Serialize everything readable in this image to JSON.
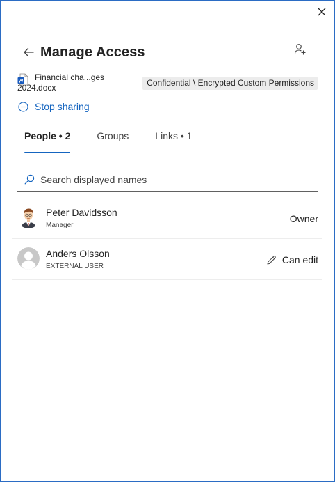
{
  "panel": {
    "title": "Manage Access",
    "close_icon": "close-icon",
    "back_icon": "arrow-left-icon",
    "add_person_icon": "person-add-icon"
  },
  "file": {
    "icon": "word-doc-icon",
    "name": "Financial cha...ges 2024.docx",
    "label": "Confidential \\ Encrypted Custom Permissions"
  },
  "stop_sharing": {
    "icon": "minus-circle-icon",
    "label": "Stop sharing"
  },
  "tabs": [
    {
      "label": "People • 2",
      "active": true
    },
    {
      "label": "Groups",
      "active": false
    },
    {
      "label": "Links • 1",
      "active": false
    }
  ],
  "search": {
    "placeholder": "Search displayed names",
    "icon": "search-icon"
  },
  "people": [
    {
      "name": "Peter Davidsson",
      "subtitle": "Manager",
      "permission": "Owner",
      "avatar": "photo-avatar"
    },
    {
      "name": "Anders Olsson",
      "subtitle": "EXTERNAL USER",
      "permission": "Can edit",
      "avatar": "default-person-avatar",
      "permission_icon": "pencil-icon"
    }
  ],
  "colors": {
    "accent": "#1565c0",
    "border": "#2b6cc4",
    "badge_bg": "#ececec"
  }
}
